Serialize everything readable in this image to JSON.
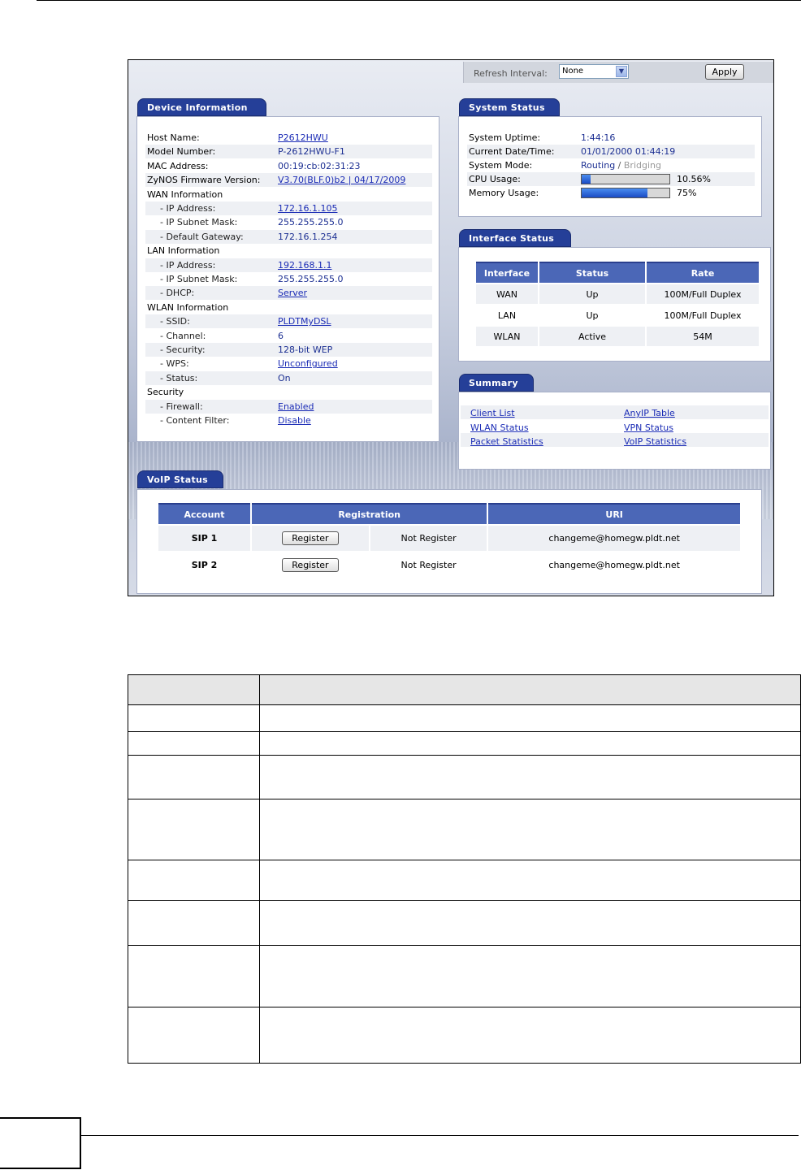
{
  "toolbar": {
    "refresh_label": "Refresh Interval:",
    "refresh_value": "None",
    "apply_label": "Apply"
  },
  "device": {
    "title": "Device Information",
    "rows": [
      {
        "label": "Host Name:",
        "value": "P2612HWU",
        "link": true
      },
      {
        "label": "Model Number:",
        "value": "P-2612HWU-F1",
        "link": false
      },
      {
        "label": "MAC Address:",
        "value": "00:19:cb:02:31:23",
        "link": false
      },
      {
        "label": "ZyNOS Firmware Version:",
        "value": "V3.70(BLF.0)b2 | 04/17/2009",
        "link": true
      },
      {
        "label": "WAN Information",
        "value": "",
        "link": false
      },
      {
        "label": "- IP Address:",
        "value": "172.16.1.105",
        "link": true
      },
      {
        "label": "- IP Subnet Mask:",
        "value": "255.255.255.0",
        "link": false
      },
      {
        "label": "- Default Gateway:",
        "value": "172.16.1.254",
        "link": false
      },
      {
        "label": "LAN Information",
        "value": "",
        "link": false
      },
      {
        "label": "- IP Address:",
        "value": "192.168.1.1",
        "link": true
      },
      {
        "label": "- IP Subnet Mask:",
        "value": "255.255.255.0",
        "link": false
      },
      {
        "label": "- DHCP:",
        "value": "Server",
        "link": true
      },
      {
        "label": "WLAN Information",
        "value": "",
        "link": false
      },
      {
        "label": "- SSID:",
        "value": "PLDTMyDSL",
        "link": true
      },
      {
        "label": "- Channel:",
        "value": "6",
        "link": false
      },
      {
        "label": "- Security:",
        "value": "128-bit WEP",
        "link": false
      },
      {
        "label": "- WPS:",
        "value": "Unconfigured",
        "link": true
      },
      {
        "label": "- Status:",
        "value": "On",
        "link": false
      },
      {
        "label": "Security",
        "value": "",
        "link": false
      },
      {
        "label": "- Firewall:",
        "value": "Enabled",
        "link": true
      },
      {
        "label": "- Content Filter:",
        "value": "Disable",
        "link": true
      }
    ]
  },
  "system": {
    "title": "System Status",
    "uptime_label": "System Uptime:",
    "uptime": "1:44:16",
    "date_label": "Current Date/Time:",
    "date": "01/01/2000 01:44:19",
    "mode_label": "System Mode:",
    "mode_routing": "Routing",
    "mode_sep": " / ",
    "mode_bridging": "Bridging",
    "cpu_label": "CPU Usage:",
    "cpu_text": "10.56%",
    "cpu_fraction": 0.1056,
    "mem_label": "Memory Usage:",
    "mem_text": "75%",
    "mem_fraction": 0.75
  },
  "interface": {
    "title": "Interface Status",
    "headers": [
      "Interface",
      "Status",
      "Rate"
    ],
    "rows": [
      [
        "WAN",
        "Up",
        "100M/Full Duplex"
      ],
      [
        "LAN",
        "Up",
        "100M/Full Duplex"
      ],
      [
        "WLAN",
        "Active",
        "54M"
      ]
    ]
  },
  "summary": {
    "title": "Summary",
    "links": [
      "Client List",
      "AnyIP Table",
      "WLAN Status",
      "VPN Status",
      "Packet Statistics",
      "VoIP Statistics"
    ]
  },
  "voip": {
    "title": "VoIP Status",
    "headers": [
      "Account",
      "Registration",
      "URI"
    ],
    "rows": [
      {
        "account": "SIP 1",
        "button": "Register",
        "status": "Not Register",
        "uri": "changeme@homegw.pldt.net"
      },
      {
        "account": "SIP 2",
        "button": "Register",
        "status": "Not Register",
        "uri": "changeme@homegw.pldt.net"
      }
    ]
  }
}
